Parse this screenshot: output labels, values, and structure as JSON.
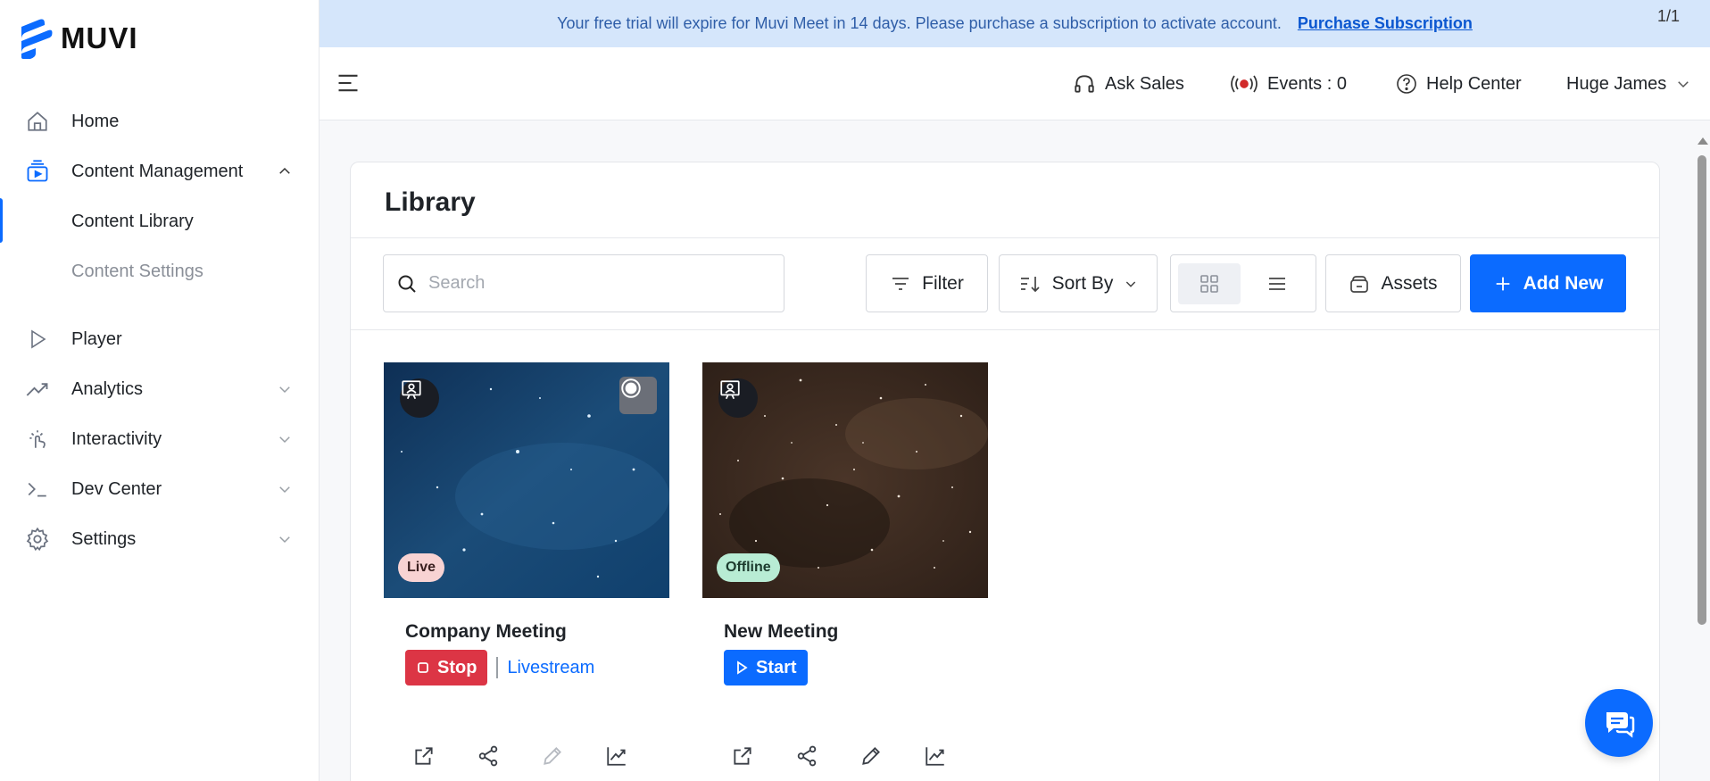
{
  "brand": {
    "name": "MUVI",
    "accent": "#0b6bff"
  },
  "banner": {
    "message": "Your free trial will expire for Muvi Meet in 14 days. Please purchase a subscription to activate account.",
    "link": "Purchase Subscription",
    "pager": "1/1"
  },
  "sidebar": {
    "items": [
      {
        "label": "Home",
        "icon": "home-icon"
      },
      {
        "label": "Content Management",
        "icon": "content-management-icon",
        "expanded": true,
        "children": [
          {
            "label": "Content Library",
            "active": true
          },
          {
            "label": "Content Settings"
          }
        ]
      },
      {
        "label": "Player",
        "icon": "play-icon"
      },
      {
        "label": "Analytics",
        "icon": "analytics-icon"
      },
      {
        "label": "Interactivity",
        "icon": "interactivity-icon"
      },
      {
        "label": "Dev Center",
        "icon": "terminal-icon"
      },
      {
        "label": "Settings",
        "icon": "gear-icon"
      }
    ]
  },
  "topbar": {
    "ask_sales": "Ask Sales",
    "events": "Events : 0",
    "help_center": "Help Center",
    "user": "Huge James"
  },
  "library": {
    "title": "Library",
    "search_placeholder": "Search",
    "filter": "Filter",
    "sort_by": "Sort By",
    "assets": "Assets",
    "add_new": "Add New",
    "view_mode": "grid"
  },
  "tiles": [
    {
      "name": "Company Meeting",
      "status": "Live",
      "status_color": "#f8d3d3",
      "action": "Stop",
      "action_color": "#dc3545",
      "link": "Livestream",
      "recording": true
    },
    {
      "name": "New Meeting",
      "status": "Offline",
      "status_color": "#b8ecd4",
      "action": "Start",
      "action_color": "#0b6bff"
    }
  ]
}
